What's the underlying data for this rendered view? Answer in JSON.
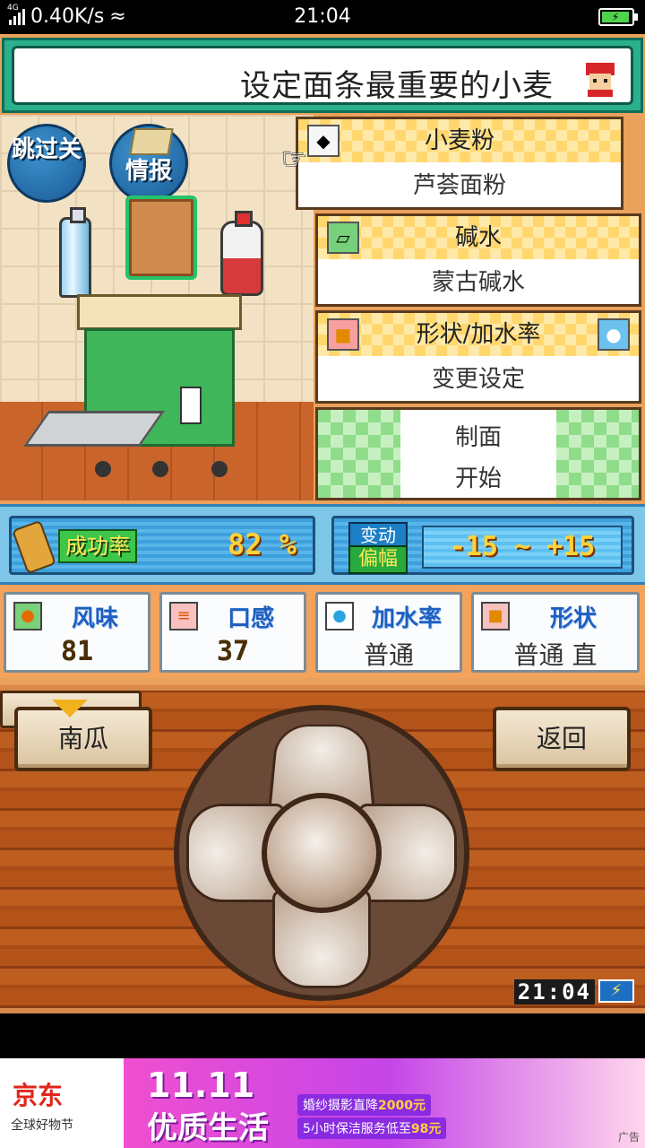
{
  "status_bar": {
    "network": "4G",
    "speed": "0.40K/s",
    "time": "21:04"
  },
  "banner": {
    "title": "设定面条最重要的小麦"
  },
  "scene": {
    "skip_label": "跳过关",
    "info_label": "情报"
  },
  "menu": {
    "flour": {
      "title": "小麦粉",
      "value": "芦荟面粉"
    },
    "alkaline": {
      "title": "碱水",
      "value": "蒙古碱水"
    },
    "shape": {
      "title": "形状/加水率",
      "value": "变更设定"
    },
    "make": {
      "line1": "制面",
      "line2": "开始"
    }
  },
  "stats": {
    "success_label": "成功率",
    "success_value": "82 %",
    "range_label_top": "变动",
    "range_label_bottom": "偏幅",
    "range_value": "-15 ~ +15"
  },
  "attributes": [
    {
      "name": "风味",
      "value": "81",
      "icon": "flavor-icon"
    },
    {
      "name": "口感",
      "value": "37",
      "icon": "texture-icon"
    },
    {
      "name": "加水率",
      "value": "普通",
      "icon": "water-drop-icon"
    },
    {
      "name": "形状",
      "value": "普通 直",
      "icon": "shape-icon"
    }
  ],
  "controls": {
    "left_button": "南瓜",
    "right_button": "返回",
    "clock": "21:04"
  },
  "ad": {
    "brand": "京东",
    "brand_sub": "全球好物节",
    "headline1": "11.11",
    "headline2": "优质生活",
    "promo1_text": "婚纱摄影直降",
    "promo1_price": "2000元",
    "promo2_text": "5小时保洁服务低至",
    "promo2_price": "98元",
    "ad_tag": "广告"
  }
}
